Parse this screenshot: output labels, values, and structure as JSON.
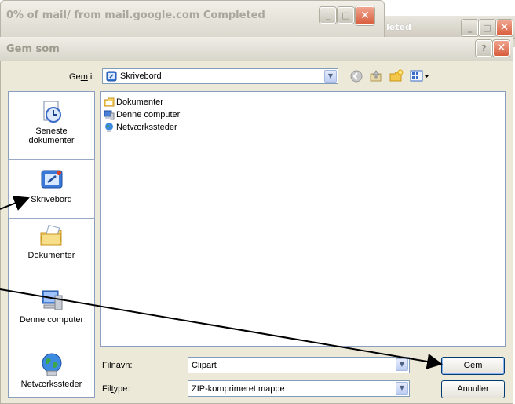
{
  "background_window": {
    "title_fragment": "leted"
  },
  "progress_window": {
    "title": "0% of mail/ from mail.google.com Completed"
  },
  "dialog": {
    "title": "Gem som"
  },
  "save_in": {
    "label_pre": "Ge",
    "label_u": "m",
    "label_post": " i:",
    "value": "Skrivebord"
  },
  "places": [
    {
      "label_line1": "Seneste",
      "label_line2": "dokumenter",
      "icon": "recent-documents-icon"
    },
    {
      "label_line1": "Skrivebord",
      "label_line2": "",
      "icon": "desktop-icon",
      "selected": true
    },
    {
      "label_line1": "Dokumenter",
      "label_line2": "",
      "icon": "my-documents-icon"
    },
    {
      "label_line1": "Denne computer",
      "label_line2": "",
      "icon": "my-computer-icon"
    },
    {
      "label_line1": "Netværkssteder",
      "label_line2": "",
      "icon": "network-places-icon"
    }
  ],
  "files": [
    {
      "name": "Dokumenter",
      "icon": "folder-icon"
    },
    {
      "name": "Denne computer",
      "icon": "computer-icon"
    },
    {
      "name": "Netværkssteder",
      "icon": "network-icon"
    }
  ],
  "filename": {
    "label_pre": "Fil",
    "label_u": "n",
    "label_post": "avn:",
    "value": "Clipart"
  },
  "filetype": {
    "label_pre": "Fil",
    "label_u": "t",
    "label_post": "ype:",
    "value": "ZIP-komprimeret mappe"
  },
  "buttons": {
    "save_u": "G",
    "save_rest": "em",
    "cancel": "Annuller"
  },
  "colors": {
    "accent": "#003c74",
    "close_red": "#d85c3c",
    "dialog_bg": "#ece9d8"
  }
}
